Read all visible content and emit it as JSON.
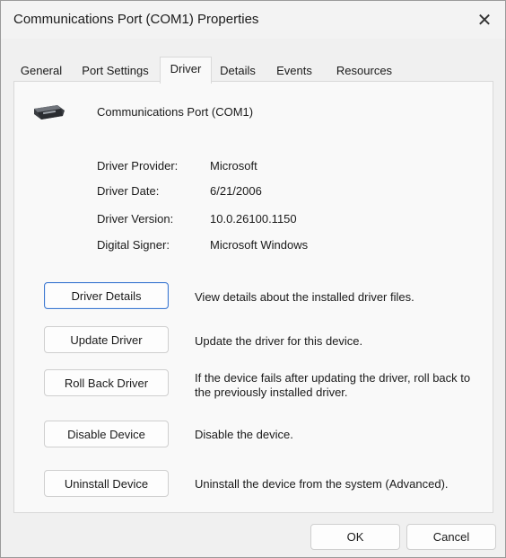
{
  "window": {
    "title": "Communications Port (COM1) Properties",
    "close_glyph": "✕"
  },
  "tabs": [
    {
      "label": "General"
    },
    {
      "label": "Port Settings"
    },
    {
      "label": "Driver",
      "active": true
    },
    {
      "label": "Details"
    },
    {
      "label": "Events"
    },
    {
      "label": "Resources"
    }
  ],
  "device": {
    "name": "Communications Port (COM1)",
    "icon": "serial-port-connector-icon"
  },
  "driver_info": [
    {
      "label": "Driver Provider:",
      "value": "Microsoft"
    },
    {
      "label": "Driver Date:",
      "value": "6/21/2006"
    },
    {
      "label": "Driver Version:",
      "value": "10.0.26100.1150"
    },
    {
      "label": "Digital Signer:",
      "value": "Microsoft Windows"
    }
  ],
  "actions": [
    {
      "label": "Driver Details",
      "description": "View details about the installed driver files."
    },
    {
      "label": "Update Driver",
      "description": "Update the driver for this device."
    },
    {
      "label": "Roll Back Driver",
      "description": "If the device fails after updating the driver, roll back to the previously installed driver."
    },
    {
      "label": "Disable Device",
      "description": "Disable the device."
    },
    {
      "label": "Uninstall Device",
      "description": "Uninstall the device from the system (Advanced)."
    }
  ],
  "footer": {
    "ok_label": "OK",
    "cancel_label": "Cancel"
  },
  "colors": {
    "focus_border": "#3f7ad1",
    "panel_bg": "#f9f9f9",
    "window_bg": "#f0f0f0"
  }
}
